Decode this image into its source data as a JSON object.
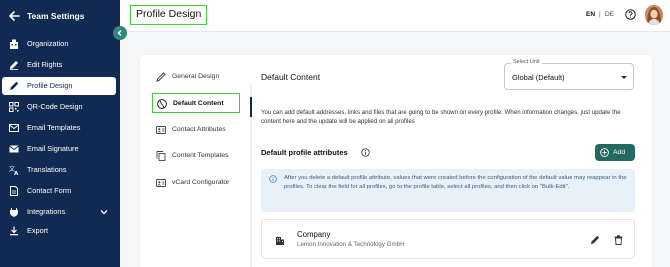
{
  "sidebar": {
    "title": "Team Settings",
    "items": [
      {
        "label": "Organization",
        "icon": "organization-icon"
      },
      {
        "label": "Edit Rights",
        "icon": "edit-rights-icon"
      },
      {
        "label": "Profile Design",
        "icon": "profile-design-icon",
        "active": true
      },
      {
        "label": "QR-Code Design",
        "icon": "qr-code-icon"
      },
      {
        "label": "Email Templates",
        "icon": "email-icon"
      },
      {
        "label": "Email Signature",
        "icon": "email-signature-icon"
      },
      {
        "label": "Translations",
        "icon": "translate-icon"
      },
      {
        "label": "Contact Form",
        "icon": "contact-form-icon"
      },
      {
        "label": "Integrations",
        "icon": "integrations-icon",
        "has_dropdown": true
      },
      {
        "label": "Export",
        "icon": "export-icon"
      }
    ]
  },
  "header": {
    "page_title": "Profile Design",
    "lang_en": "EN",
    "lang_sep": "|",
    "lang_de": "DE",
    "active_language": "EN"
  },
  "tabs": [
    {
      "label": "General Design",
      "icon": "brush-icon"
    },
    {
      "label": "Default Content",
      "icon": "globe-icon",
      "active": true
    },
    {
      "label": "Contact Attributes",
      "icon": "contact-card-icon"
    },
    {
      "label": "Content Templates",
      "icon": "copy-icon"
    },
    {
      "label": "vCard Configurator",
      "icon": "vcard-icon"
    }
  ],
  "content": {
    "title": "Default Content",
    "select_unit": {
      "legend": "Select Unit",
      "value": "Global (Default)"
    },
    "description": "You can add default addresses, links and files that are going to be shown on every profile. When information changes, just update the content here and the update will be applied on all profiles",
    "section_title": "Default profile attributes",
    "add_label": "Add",
    "info_text": "After you delete a default profile attribute, values that were created before the configuration of the default value may reappear in the profiles. To clear the field for all profiles, go to the profile table, select all profiles, and then click on \"Bulk-Edit\".",
    "attributes": [
      {
        "name": "Company",
        "value": "Lemon Innovation & Technology GmbH",
        "icon": "building-icon"
      }
    ]
  },
  "colors": {
    "sidebar_bg": "#122a52",
    "accent_green": "#22695f",
    "highlight_outline": "#3ecf3e",
    "info_bg": "#e8f1fa"
  }
}
